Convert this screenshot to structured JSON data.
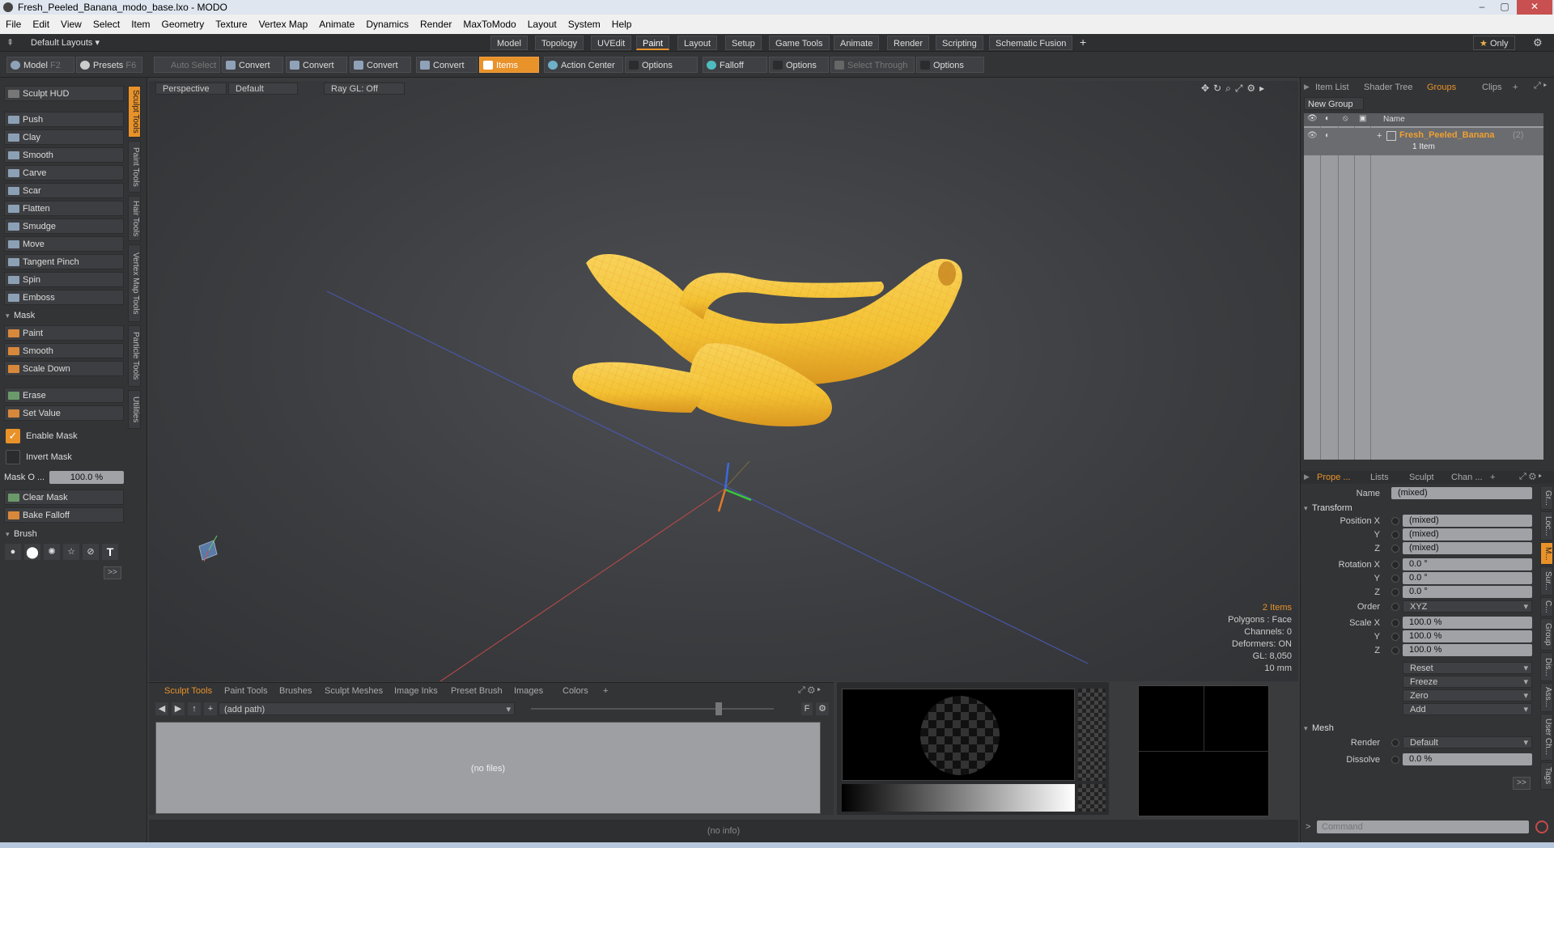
{
  "title": "Fresh_Peeled_Banana_modo_base.lxo - MODO",
  "menu": [
    "File",
    "Edit",
    "View",
    "Select",
    "Item",
    "Geometry",
    "Texture",
    "Vertex Map",
    "Animate",
    "Dynamics",
    "Render",
    "MaxToModo",
    "Layout",
    "System",
    "Help"
  ],
  "layouts": {
    "selector": "Default Layouts",
    "tabs": [
      "Model",
      "Topology",
      "UVEdit",
      "Paint",
      "Layout",
      "Setup",
      "Game Tools",
      "Animate",
      "Render",
      "Scripting",
      "Schematic Fusion"
    ],
    "active": "Paint",
    "plus": "+",
    "only": "Only"
  },
  "toolbar": {
    "model": "Model",
    "model_key": "F2",
    "presets": "Presets",
    "presets_key": "F6",
    "auto_select": "Auto Select",
    "convert": "Convert",
    "items": "Items",
    "action_center": "Action Center",
    "options": "Options",
    "falloff": "Falloff",
    "select_through": "Select Through"
  },
  "left": {
    "hud": "Sculpt HUD",
    "tools": [
      "Push",
      "Clay",
      "Smooth",
      "Carve",
      "Scar",
      "Flatten",
      "Smudge",
      "Move",
      "Tangent Pinch",
      "Spin",
      "Emboss"
    ],
    "mask_title": "Mask",
    "mask_tools": [
      "Paint",
      "Smooth",
      "Scale Down"
    ],
    "erase": "Erase",
    "set_value": "Set Value",
    "enable_mask": "Enable Mask",
    "invert_mask": "Invert Mask",
    "mask_opacity_label": "Mask O ...",
    "mask_opacity": "100.0 %",
    "clear_mask": "Clear Mask",
    "bake_falloff": "Bake Falloff",
    "brush_title": "Brush",
    "more": ">>",
    "side_tabs": [
      "Sculpt Tools",
      "Paint Tools",
      "Hair Tools",
      "Vertex Map Tools",
      "Particle Tools",
      "Utilities"
    ]
  },
  "viewport": {
    "perspective": "Perspective",
    "default": "Default",
    "raygl": "Ray GL: Off",
    "info": {
      "items": "2 Items",
      "polygons": "Polygons : Face",
      "channels": "Channels: 0",
      "deformers": "Deformers: ON",
      "gl": "GL: 8,050",
      "scale": "10 mm"
    }
  },
  "bottom": {
    "tabs": [
      "Sculpt Tools",
      "Paint Tools",
      "Brushes",
      "Sculpt Meshes",
      "Image Inks",
      "Preset Brush",
      "Images",
      "Colors",
      "+"
    ],
    "path": "(add path)",
    "nofiles": "(no files)",
    "f": "F"
  },
  "status": "(no info)",
  "right": {
    "top_tabs": [
      "Item List",
      "Shader Tree",
      "Groups",
      "Clips",
      "+"
    ],
    "top_active": "Groups",
    "new_group": "New Group",
    "col_name": "Name",
    "group_name": "Fresh_Peeled_Banana",
    "group_count": "(2)",
    "group_sub": "1 Item",
    "prop_tabs": [
      "Prope ...",
      "Lists",
      "Sculpt",
      "Chan ...",
      "+"
    ],
    "name_label": "Name",
    "name_value": "(mixed)",
    "transform": "Transform",
    "pos_label": "Position X",
    "pos": [
      "(mixed)",
      "(mixed)",
      "(mixed)"
    ],
    "rot_label": "Rotation X",
    "rot": [
      "0.0 °",
      "0.0 °",
      "0.0 °"
    ],
    "axis_y": "Y",
    "axis_z": "Z",
    "order_label": "Order",
    "order": "XYZ",
    "scale_label": "Scale X",
    "scale": [
      "100.0 %",
      "100.0 %",
      "100.0 %"
    ],
    "actions": [
      "Reset",
      "Freeze",
      "Zero",
      "Add"
    ],
    "mesh": "Mesh",
    "render_label": "Render",
    "render_value": "Default",
    "dissolve_label": "Dissolve",
    "dissolve_value": "0.0 %",
    "more": ">>",
    "vtabs": [
      "Gr...",
      "Loc...",
      "M...",
      "Sur...",
      "C...",
      "Group",
      "Dis...",
      "Ass...",
      "User Ch...",
      "Tags"
    ],
    "command_placeholder": "Command",
    "prompt": ">"
  },
  "colors": {
    "accent": "#e8922a",
    "banana": "#f3c232",
    "wire": "#e8922a"
  }
}
